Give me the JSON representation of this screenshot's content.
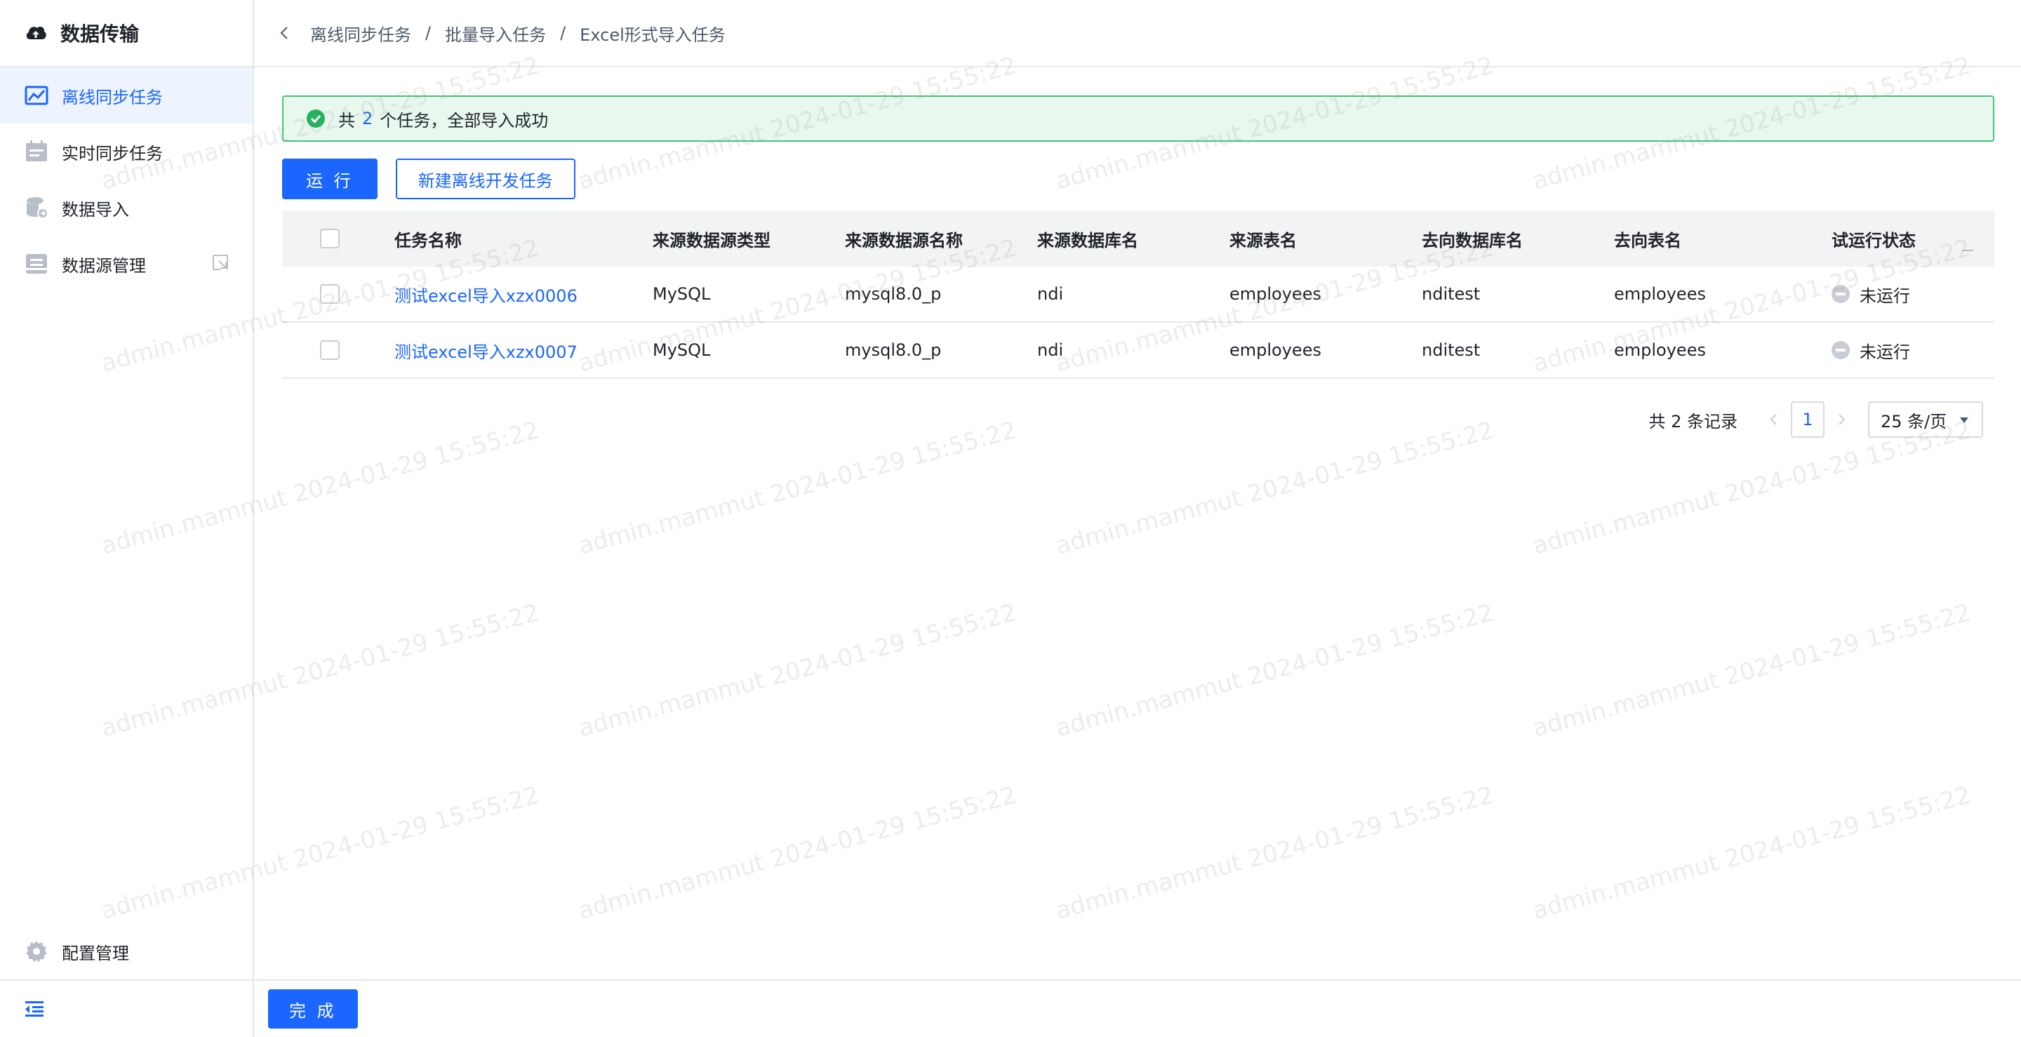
{
  "sidebar": {
    "brand_title": "数据传输",
    "items": [
      {
        "label": "离线同步任务",
        "icon": "chart-window-icon",
        "active": true
      },
      {
        "label": "实时同步任务",
        "icon": "calendar-list-icon",
        "active": false
      },
      {
        "label": "数据导入",
        "icon": "database-import-icon",
        "active": false
      },
      {
        "label": "数据源管理",
        "icon": "inbox-tray-icon",
        "active": false
      }
    ],
    "config_label": "配置管理"
  },
  "breadcrumb": [
    "离线同步任务",
    "批量导入任务",
    "Excel形式导入任务"
  ],
  "alert": {
    "prefix": "共",
    "count": "2",
    "suffix": "个任务，全部导入成功"
  },
  "toolbar": {
    "run_label": "运 行",
    "new_task_label": "新建离线开发任务"
  },
  "table": {
    "headers": [
      "任务名称",
      "来源数据源类型",
      "来源数据源名称",
      "来源数据库名",
      "来源表名",
      "去向数据库名",
      "去向表名",
      "试运行状态"
    ],
    "rows": [
      {
        "task_name": "测试excel导入xzx0006",
        "src_type": "MySQL",
        "src_name": "mysql8.0_p",
        "src_db": "ndi",
        "src_table": "employees",
        "dst_db": "nditest",
        "dst_table": "employees",
        "status": "未运行"
      },
      {
        "task_name": "测试excel导入xzx0007",
        "src_type": "MySQL",
        "src_name": "mysql8.0_p",
        "src_db": "ndi",
        "src_table": "employees",
        "dst_db": "nditest",
        "dst_table": "employees",
        "status": "未运行"
      }
    ]
  },
  "pagination": {
    "total_text": "共 2 条记录",
    "current_page": "1",
    "page_size": "25 条/页"
  },
  "footer": {
    "done_label": "完 成"
  },
  "watermark_text": "admin.mammut 2024-01-29 15:55:22",
  "colors": {
    "primary": "#1a66ff",
    "success_border": "#3ec67a",
    "success_bg": "#e8f8ee",
    "active_bg": "#eef4ff"
  }
}
